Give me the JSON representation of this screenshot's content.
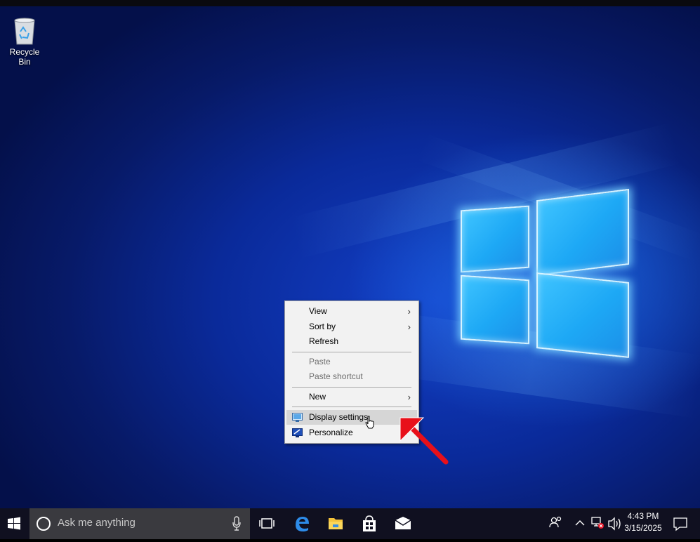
{
  "desktop": {
    "icons": [
      {
        "label": "Recycle Bin"
      }
    ]
  },
  "context_menu": {
    "items": [
      {
        "label": "View",
        "submenu": true,
        "enabled": true
      },
      {
        "label": "Sort by",
        "submenu": true,
        "enabled": true
      },
      {
        "label": "Refresh",
        "submenu": false,
        "enabled": true
      },
      {
        "label": "Paste",
        "submenu": false,
        "enabled": false
      },
      {
        "label": "Paste shortcut",
        "submenu": false,
        "enabled": false
      },
      {
        "label": "New",
        "submenu": true,
        "enabled": true
      },
      {
        "label": "Display settings",
        "submenu": false,
        "enabled": true,
        "highlighted": true,
        "icon": "display-icon"
      },
      {
        "label": "Personalize",
        "submenu": false,
        "enabled": true,
        "icon": "personalize-icon"
      }
    ]
  },
  "taskbar": {
    "search_placeholder": "Ask me anything",
    "pinned": [
      "task-view-icon",
      "edge-icon",
      "file-explorer-icon",
      "store-icon",
      "mail-icon"
    ],
    "tray_icons": [
      "people-icon",
      "chevron-up-icon",
      "network-icon",
      "volume-icon",
      "action-center-icon"
    ],
    "time": "4:43 PM",
    "date": "3/15/2025"
  },
  "colors": {
    "accent": "#1da8f5",
    "taskbar": "#101020",
    "menu_bg": "#f2f2f2",
    "annotation_arrow": "#e8101a"
  }
}
